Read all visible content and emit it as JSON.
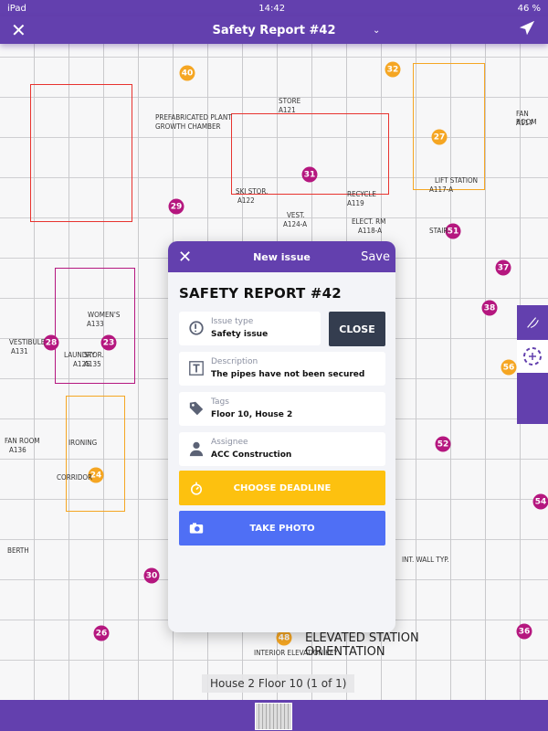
{
  "status_bar": {
    "device": "iPad",
    "time": "14:42",
    "battery": "46 %"
  },
  "header": {
    "title": "Safety Report #42",
    "close_icon": "close-icon",
    "send_icon": "send-icon"
  },
  "plan": {
    "labels": [
      "LAUNDRY",
      "A125",
      "IRONING",
      "PREFABRICATED PLANT",
      "GROWTH CHAMBER",
      "STORE",
      "A121",
      "ELECT. RM",
      "A118-A",
      "FAN ROOM",
      "A117",
      "LIFT STATION",
      "A117-A",
      "SKI STOR.",
      "A122",
      "VEST.",
      "A124-A",
      "RECYCLE",
      "A119",
      "WOMEN'S",
      "A133",
      "STOR.",
      "A135",
      "VESTIBULE",
      "A131",
      "FAN ROOM",
      "A136",
      "BERTH",
      "CORRIDOR",
      "STAIR",
      "INT. WALL TYP.",
      "INTERIOR ELEVATION KEY"
    ],
    "annotation_title": [
      "ELEVATED STATION",
      "ORIENTATION"
    ],
    "pins": [
      {
        "n": "40",
        "c": "orange"
      },
      {
        "n": "32",
        "c": "orange"
      },
      {
        "n": "27",
        "c": "orange"
      },
      {
        "n": "31",
        "c": "magenta"
      },
      {
        "n": "29",
        "c": "magenta"
      },
      {
        "n": "51",
        "c": "magenta"
      },
      {
        "n": "37",
        "c": "magenta"
      },
      {
        "n": "38",
        "c": "magenta"
      },
      {
        "n": "28",
        "c": "magenta"
      },
      {
        "n": "23",
        "c": "magenta"
      },
      {
        "n": "56",
        "c": "orange"
      },
      {
        "n": "24",
        "c": "orange"
      },
      {
        "n": "52",
        "c": "magenta"
      },
      {
        "n": "54",
        "c": "magenta"
      },
      {
        "n": "30",
        "c": "magenta"
      },
      {
        "n": "26",
        "c": "magenta"
      },
      {
        "n": "48",
        "c": "orange"
      },
      {
        "n": "36",
        "c": "magenta"
      }
    ],
    "floor_label": "House 2 Floor 10 (1 of 1)"
  },
  "colors": {
    "brand": "#6340ae",
    "orange": "#f5a623",
    "magenta": "#b5177f",
    "red": "#e8332f",
    "deadline": "#fdc10f",
    "photo": "#4f6ff5",
    "close": "#343d4f"
  },
  "modal": {
    "title": "New issue",
    "save": "Save",
    "heading": "SAFETY REPORT #42",
    "close_button": "CLOSE",
    "fields": [
      {
        "label": "Issue type",
        "value": "Safety issue",
        "icon": "issue-type-icon"
      },
      {
        "label": "Description",
        "value": "The pipes have not been secured",
        "icon": "text-icon"
      },
      {
        "label": "Tags",
        "value": "Floor 10, House 2",
        "icon": "tag-icon"
      },
      {
        "label": "Assignee",
        "value": "ACC Construction",
        "icon": "person-icon"
      }
    ],
    "deadline_button": "CHOOSE DEADLINE",
    "photo_button": "TAKE PHOTO"
  }
}
